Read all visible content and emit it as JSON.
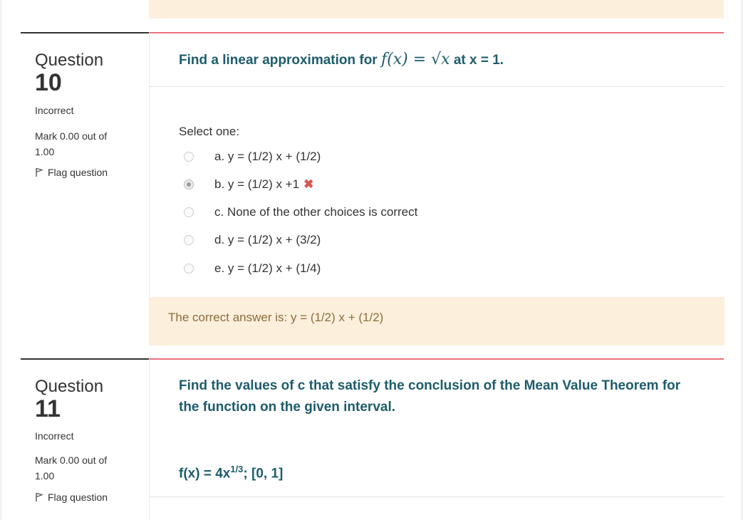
{
  "questions": [
    {
      "label": "Question",
      "number": "10",
      "state": "Incorrect",
      "grade": "Mark 0.00 out of 1.00",
      "flag_label": "Flag question",
      "text_before": "Find a linear approximation for ",
      "math": "f(x) = √x",
      "text_after": " at x = 1.",
      "prompt": "Select one:",
      "options": [
        {
          "label": "a. y = (1/2) x + (1/2)",
          "selected": false
        },
        {
          "label": "b. y = (1/2) x +1",
          "selected": true,
          "incorrect": true
        },
        {
          "label": "c. None of the other choices is correct",
          "selected": false
        },
        {
          "label": "d. y = (1/2) x + (3/2)",
          "selected": false
        },
        {
          "label": "e. y = (1/2) x + (1/4)",
          "selected": false
        }
      ],
      "feedback": "The correct answer is: y = (1/2) x + (1/2)"
    },
    {
      "label": "Question",
      "number": "11",
      "state": "Incorrect",
      "grade": "Mark 0.00 out of 1.00",
      "flag_label": "Flag question",
      "text": "Find the values of c that satisfy the conclusion of the Mean Value Theorem for the function on the given interval.",
      "formula_base": "f(x) = 4x",
      "formula_exp": "1/3",
      "formula_tail": "; [0, 1]"
    }
  ],
  "icons": {
    "flag": "flag-icon",
    "incorrect": "cross-icon"
  },
  "colors": {
    "accent": "#e8707a",
    "question_text": "#1e5c6b",
    "feedback_bg": "#fcefdc",
    "incorrect": "#d9534f"
  }
}
